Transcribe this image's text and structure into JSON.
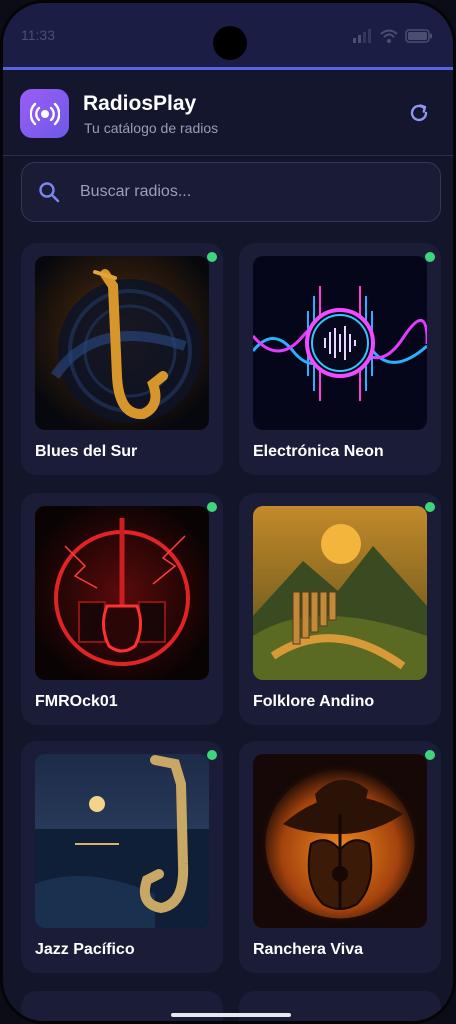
{
  "status": {
    "time": "11:33"
  },
  "header": {
    "title": "RadiosPlay",
    "subtitle": "Tu catálogo de radios"
  },
  "search": {
    "placeholder": "Buscar radios..."
  },
  "stations": [
    {
      "name": "Blues del Sur",
      "live": true
    },
    {
      "name": "Electrónica Neon",
      "live": true
    },
    {
      "name": "FMROck01",
      "live": true
    },
    {
      "name": "Folklore Andino",
      "live": true
    },
    {
      "name": "Jazz Pacífico",
      "live": true
    },
    {
      "name": "Ranchera Viva",
      "live": true
    }
  ],
  "colors": {
    "accent": "#5a63e0",
    "live": "#3fd67b",
    "logo_start": "#9b5cf6",
    "logo_end": "#6d5ae8"
  }
}
